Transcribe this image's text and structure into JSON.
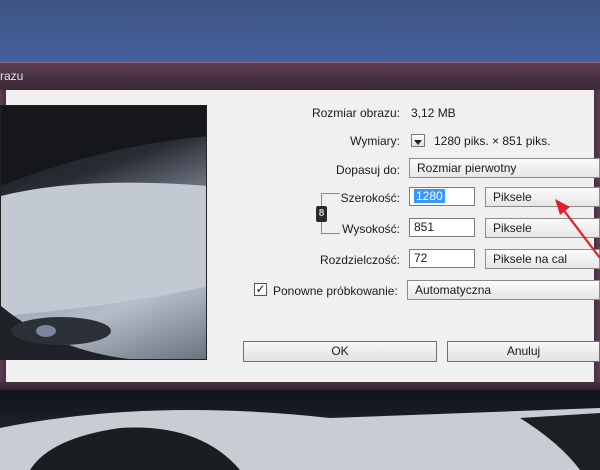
{
  "window": {
    "title": "razu"
  },
  "info": {
    "image_size_label": "Rozmiar obrazu:",
    "image_size_value": "3,12 MB",
    "dimensions_label": "Wymiary:",
    "dimensions_value": "1280 piks. × 851 piks.",
    "fit_label": "Dopasuj do:",
    "fit_value": "Rozmiar pierwotny"
  },
  "size": {
    "width_label": "Szerokość:",
    "width_value": "1280",
    "width_unit": "Piksele",
    "height_label": "Wysokość:",
    "height_value": "851",
    "height_unit": "Piksele",
    "resolution_label": "Rozdzielczość:",
    "resolution_value": "72",
    "resolution_unit": "Piksele na cal"
  },
  "resample": {
    "label": "Ponowne próbkowanie:",
    "checked": true,
    "check_glyph": "✓",
    "value": "Automatyczna"
  },
  "buttons": {
    "ok": "OK",
    "cancel": "Anuluj"
  },
  "chain_glyph": "8",
  "annotation_color": "#e0202a"
}
